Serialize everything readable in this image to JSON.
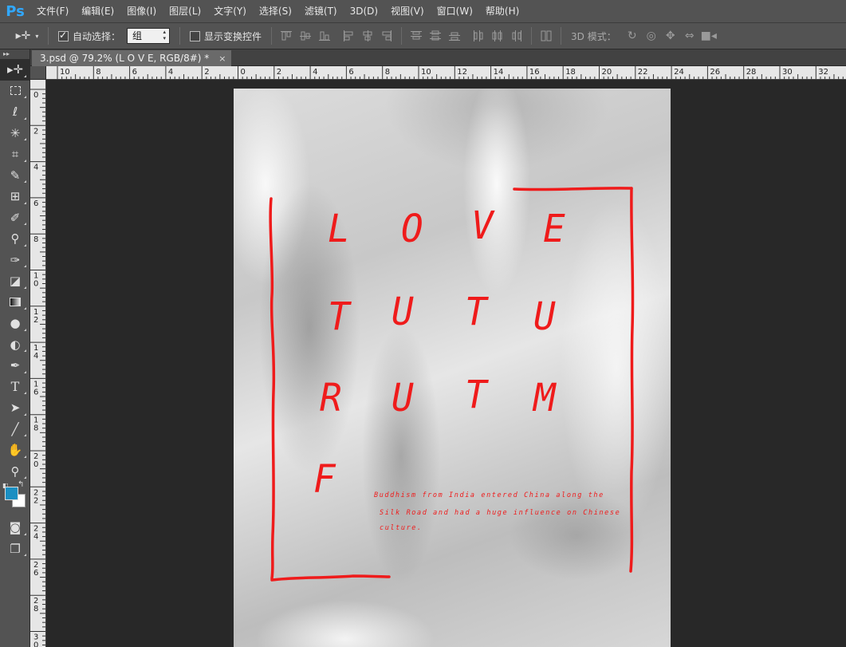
{
  "app": {
    "logo": "Ps"
  },
  "menu": [
    "文件(F)",
    "编辑(E)",
    "图像(I)",
    "图层(L)",
    "文字(Y)",
    "选择(S)",
    "滤镜(T)",
    "3D(D)",
    "视图(V)",
    "窗口(W)",
    "帮助(H)"
  ],
  "options": {
    "auto_select_label": "自动选择：",
    "auto_select_checked": true,
    "auto_select_value": "组",
    "show_transform_label": "显示变换控件",
    "show_transform_checked": false,
    "mode3d_label": "3D 模式："
  },
  "document": {
    "tab_title": "3.psd @ 79.2% (L O V E, RGB/8#) *",
    "close_glyph": "×"
  },
  "rulers": {
    "horizontal": [
      "10",
      "8",
      "6",
      "4",
      "2",
      "0",
      "2",
      "4",
      "6",
      "8",
      "10",
      "12",
      "14",
      "16",
      "18",
      "20",
      "22",
      "24",
      "26",
      "28",
      "30",
      "32"
    ],
    "vertical": [
      "0",
      "2",
      "4",
      "6",
      "8",
      "10",
      "12",
      "14",
      "16",
      "18",
      "20",
      "22",
      "24",
      "26",
      "28",
      "30"
    ]
  },
  "colors": {
    "foreground": "#1b8fc2",
    "background": "#ffffff",
    "artwork_red": "#ef1b1b"
  },
  "artwork": {
    "rows": [
      [
        "L",
        "O",
        "V",
        "E"
      ],
      [
        "T",
        "U",
        "T",
        "U"
      ],
      [
        "R",
        "U",
        "T",
        "M"
      ],
      [
        "F"
      ]
    ],
    "caption_lines": [
      "Buddhism from India entered China along the",
      "Silk Road and had a huge influence on Chinese",
      "culture."
    ]
  },
  "tools": [
    "move-tool",
    "marquee-tool",
    "lasso-tool",
    "magic-wand-tool",
    "crop-tool",
    "eyedropper-tool",
    "spot-healing-tool",
    "brush-tool",
    "clone-stamp-tool",
    "history-brush-tool",
    "eraser-tool",
    "gradient-tool",
    "blur-tool",
    "dodge-tool",
    "pen-tool",
    "type-tool",
    "path-selection-tool",
    "line-tool",
    "hand-tool",
    "zoom-tool"
  ]
}
